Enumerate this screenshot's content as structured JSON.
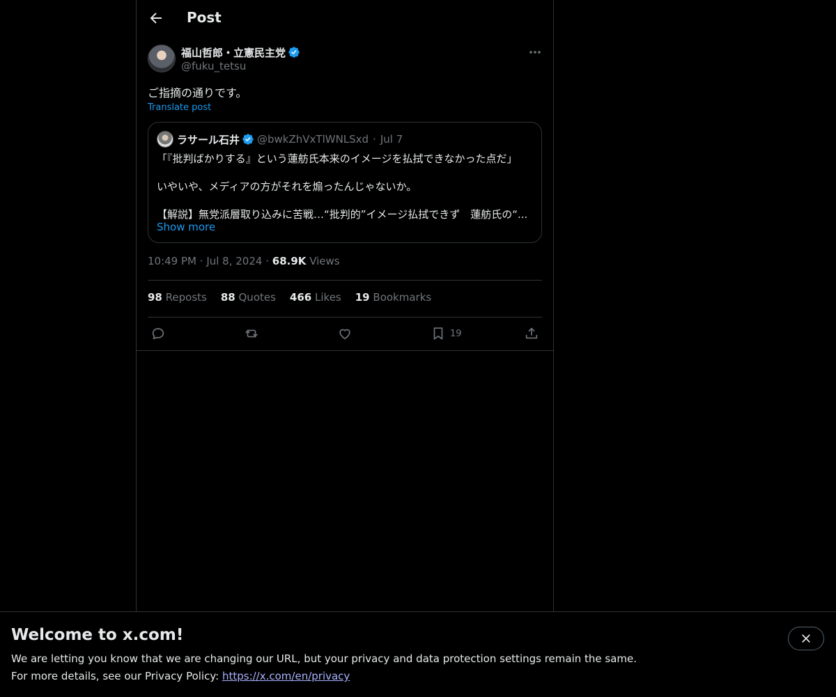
{
  "header": {
    "title": "Post"
  },
  "post": {
    "author_name": "福山哲郎・立憲民主党",
    "author_handle": "@fuku_tetsu",
    "text": "ご指摘の通りです。",
    "translate_label": "Translate post",
    "time": "10:49 PM",
    "date": "Jul 8, 2024",
    "views_count": "68.9K",
    "views_label": "Views"
  },
  "quote": {
    "author_name": "ラサール石井",
    "author_handle": "@bwkZhVxTlWNLSxd",
    "date": "Jul 7",
    "line1": "「『批判ばかりする』という蓮舫氏本来のイメージを払拭できなかった点だ」",
    "line2": "いやいや、メディアの方がそれを煽ったんじゃないか。",
    "line3": "【解説】無党派層取り込みに苦戦…“批判的”イメージ払拭できず　蓮舫氏の“...",
    "show_more": "Show more"
  },
  "stats": {
    "reposts": {
      "count": "98",
      "label": "Reposts"
    },
    "quotes": {
      "count": "88",
      "label": "Quotes"
    },
    "likes": {
      "count": "466",
      "label": "Likes"
    },
    "bookmarks": {
      "count": "19",
      "label": "Bookmarks"
    }
  },
  "actions": {
    "bookmark_count": "19"
  },
  "banner": {
    "title": "Welcome to x.com!",
    "text1": "We are letting you know that we are changing our URL, but your privacy and data protection settings remain the same.",
    "text2": "For more details, see our Privacy Policy:",
    "link": "https://x.com/en/privacy"
  },
  "icons": [
    "back-arrow-icon",
    "verified-badge-icon",
    "more-icon",
    "reply-icon",
    "repost-icon",
    "like-icon",
    "bookmark-icon",
    "share-icon",
    "close-icon"
  ],
  "colors": {
    "background": "#000000",
    "text": "#e7e9ea",
    "muted": "#71767b",
    "accent": "#1d9bf0",
    "border": "#2f3336",
    "link": "#a8b3ff"
  }
}
